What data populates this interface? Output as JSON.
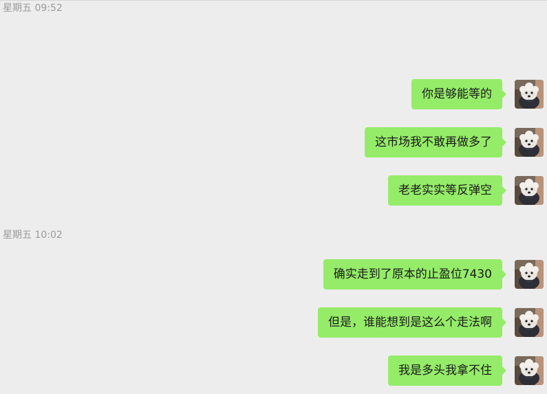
{
  "colors": {
    "background": "#ededed",
    "bubble_outgoing": "#95ec69",
    "timestamp_text": "#9a9a9a"
  },
  "chat": {
    "groups": [
      {
        "timestamp": "星期五 09:52",
        "messages": [
          {
            "text": "你是够能等的",
            "avatar": "user-avatar"
          },
          {
            "text": "这市场我不敢再做多了",
            "avatar": "user-avatar"
          },
          {
            "text": "老老实实等反弹空",
            "avatar": "user-avatar"
          }
        ]
      },
      {
        "timestamp": "星期五 10:02",
        "messages": [
          {
            "text": "确实走到了原本的止盈位7430",
            "avatar": "user-avatar"
          },
          {
            "text": "但是，谁能想到是这么个走法啊",
            "avatar": "user-avatar"
          },
          {
            "text": "我是多头我拿不住",
            "avatar": "user-avatar"
          }
        ]
      }
    ]
  }
}
